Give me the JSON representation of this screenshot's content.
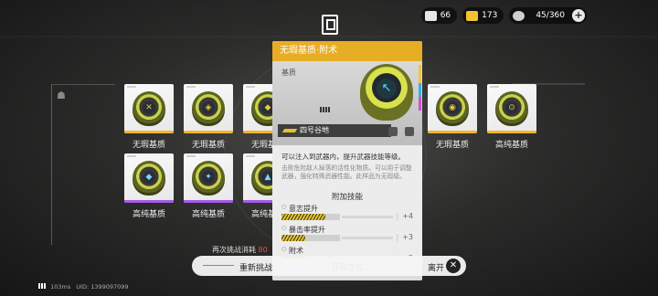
{
  "top_bar": {
    "resources": [
      {
        "name": "image-icon",
        "value": "66",
        "color": "#ffffff"
      },
      {
        "name": "ticket-icon",
        "value": "173",
        "color": "#f2c230"
      },
      {
        "name": "battery-icon",
        "value": "45/360",
        "color": "#e5e5e5"
      }
    ],
    "add_label": "+"
  },
  "items": [
    {
      "label": "无瑕基质",
      "rarity": "gold",
      "glyph": "✕"
    },
    {
      "label": "无瑕基质",
      "rarity": "gold",
      "glyph": "◈"
    },
    {
      "label": "无瑕基质",
      "rarity": "gold",
      "glyph": "◆"
    },
    {
      "label": "高纯基质",
      "rarity": "purple",
      "glyph": "◆"
    },
    {
      "label": "高纯基质",
      "rarity": "purple",
      "glyph": "✦"
    },
    {
      "label": "高纯基质",
      "rarity": "purple",
      "glyph": "▲"
    },
    {
      "label": "无瑕基质",
      "rarity": "gold",
      "glyph": "◉"
    },
    {
      "label": "高纯基质",
      "rarity": "gold",
      "glyph": "⊙"
    }
  ],
  "detail": {
    "title": "无瑕基质·附术",
    "category": "基质",
    "owner": "四号谷地",
    "description": "可以注入到武器内，提升武器技能等级。",
    "lore": "击败危险敌人掉落的活性化物质。可以用于调整武器，强化特殊武器性能。此样品为无瑕级。",
    "skills_title": "附加技能",
    "skills": [
      {
        "name": "意志提升",
        "level": 0.75,
        "bonus": "+4"
      },
      {
        "name": "暴击率提升",
        "level": 0.4,
        "bonus": "+3"
      },
      {
        "name": "附术",
        "level": 0.4,
        "bonus": "+3"
      }
    ],
    "obtain_title": "获取方式",
    "accent_color": "#e7ad25"
  },
  "bottom": {
    "retry_cost_label": "再次挑战消耗",
    "retry_cost_value": "80",
    "retry_button": "重新挑战",
    "leave_button": "离开",
    "close_glyph": "✕",
    "ping": "103ms",
    "uid": "UID: 1399097099"
  }
}
